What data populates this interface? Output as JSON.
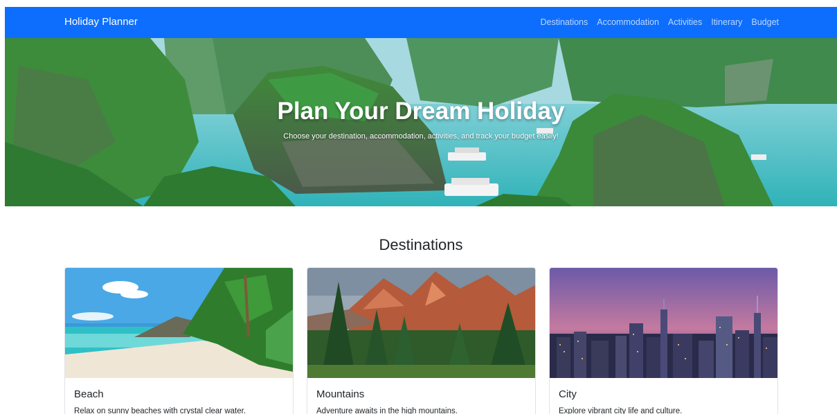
{
  "navbar": {
    "brand": "Holiday Planner",
    "links": [
      "Destinations",
      "Accommodation",
      "Activities",
      "Itinerary",
      "Budget"
    ]
  },
  "hero": {
    "title": "Plan Your Dream Holiday",
    "subtitle": "Choose your destination, accommodation, activities, and track your budget easily!"
  },
  "destinations": {
    "heading": "Destinations",
    "cards": [
      {
        "title": "Beach",
        "text": "Relax on sunny beaches with crystal clear water."
      },
      {
        "title": "Mountains",
        "text": "Adventure awaits in the high mountains."
      },
      {
        "title": "City",
        "text": "Explore vibrant city life and culture."
      }
    ]
  },
  "colors": {
    "navbar": "#0d6efd",
    "text": "#212529"
  }
}
